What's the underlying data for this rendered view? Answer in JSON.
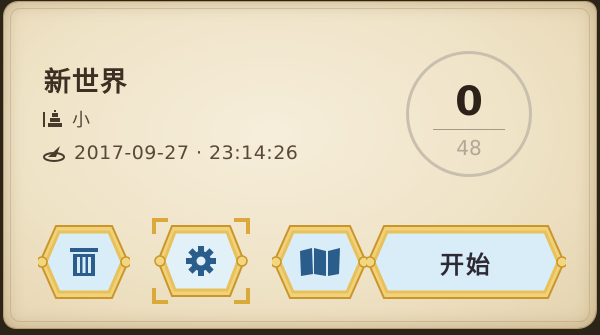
{
  "world": {
    "name": "新世界",
    "size_icon": "building-size-icon",
    "size_label": "小",
    "date_icon": "sundial-icon",
    "datetime": "2017-09-27 · 23:14:26"
  },
  "score": {
    "current": "0",
    "total": "48"
  },
  "buttons": {
    "delete_icon": "trash-icon",
    "settings_icon": "gear-icon",
    "map_icon": "map-icon",
    "start_label": "开始"
  },
  "colors": {
    "parchment": "#efe3c6",
    "gold_frame": "#e5b94b",
    "button_blue": "#cfe6f3",
    "icon_blue": "#2a5d8c",
    "text_dark": "#3d2f22"
  }
}
